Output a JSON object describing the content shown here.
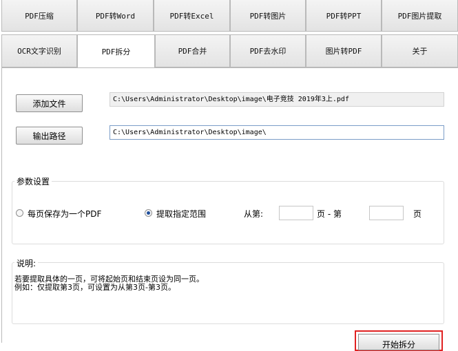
{
  "tabs_row1": [
    "PDF压缩",
    "PDF转Word",
    "PDF转Excel",
    "PDF转图片",
    "PDF转PPT",
    "PDF图片提取"
  ],
  "tabs_row2": [
    "OCR文字识别",
    "PDF拆分",
    "PDF合并",
    "PDF去水印",
    "图片转PDF",
    "关于"
  ],
  "active_tab": "PDF拆分",
  "file": {
    "add_button": "添加文件",
    "path": "C:\\Users\\Administrator\\Desktop\\image\\电子竞技 2019年3上.pdf"
  },
  "output": {
    "button": "输出路径",
    "path": "C:\\Users\\Administrator\\Desktop\\image\\"
  },
  "params": {
    "legend": "参数设置",
    "option_each_page": "每页保存为一个PDF",
    "option_range": "提取指定范围",
    "selected": "range",
    "from_label": "从第:",
    "page_to_label": "页 - 第",
    "page_label": "页",
    "from_value": "",
    "to_value": ""
  },
  "description": {
    "legend": "说明:",
    "line1": "若要提取具体的一页，可将起始页和结束页设为同一页。",
    "line2": "例如：仅提取第3页，可设置为从第3页-第3页。"
  },
  "start_button": "开始拆分"
}
